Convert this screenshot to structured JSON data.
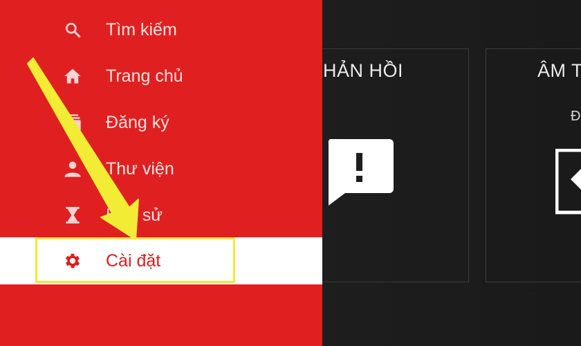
{
  "colors": {
    "drawer": "#e02020",
    "selected_row": "#ffffff",
    "selected_text": "#e01b1b",
    "annotation": "#f1e833",
    "background": "#1c1c1c"
  },
  "drawer": {
    "items": [
      {
        "label": "Tìm kiếm",
        "icon": "search-icon"
      },
      {
        "label": "Trang chủ",
        "icon": "home-icon"
      },
      {
        "label": "Đăng ký",
        "icon": "subscriptions-icon"
      },
      {
        "label": "Thư viện",
        "icon": "person-icon"
      },
      {
        "label": "Lịch sử",
        "icon": "hourglass-icon"
      },
      {
        "label": "Cài đặt",
        "icon": "gear-icon",
        "selected": true
      }
    ]
  },
  "cards": {
    "feedback": {
      "title": "HẢN HỒI",
      "icon": "feedback-icon"
    },
    "sound": {
      "title": "ÂM T",
      "subtitle": "Đ",
      "icon": "sound-icon"
    }
  },
  "annotation": {
    "type": "arrow",
    "points_to": "Cài đặt"
  }
}
